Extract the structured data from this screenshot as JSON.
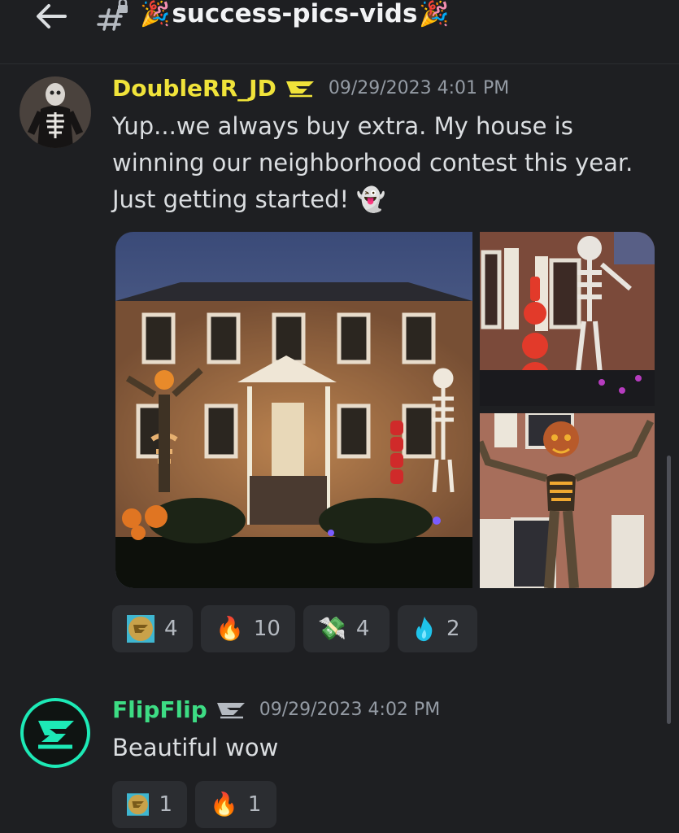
{
  "header": {
    "channel_prefix_emoji": "🎉",
    "channel_name": "success-pics-vids",
    "channel_suffix_emoji": "🎉"
  },
  "messages": [
    {
      "author": "DoubleRR_JD",
      "author_color": "#f0e33a",
      "timestamp": "09/29/2023 4:01 PM",
      "lines": [
        "Yup...we always buy extra. My house is",
        "winning our neighborhood contest this year.",
        "Just getting started! 👻"
      ],
      "images": [
        "halloween-house-front",
        "skull-column-and-skeleton",
        "pumpkin-skeleton-closeup"
      ],
      "reactions": [
        {
          "icon": "flipflip-coin-emoji",
          "count": "4"
        },
        {
          "emoji": "🔥",
          "count": "10"
        },
        {
          "emoji": "💸",
          "count": "4"
        },
        {
          "icon": "blue-fire-emoji",
          "count": "2"
        }
      ]
    },
    {
      "author": "FlipFlip",
      "author_color": "#3ddc84",
      "timestamp": "09/29/2023 4:02 PM",
      "lines": [
        "Beautiful wow"
      ],
      "reactions": [
        {
          "icon": "flipflip-coin-emoji",
          "count": "1"
        },
        {
          "emoji": "🔥",
          "count": "1"
        }
      ]
    }
  ],
  "colors": {
    "background": "#1e1f22",
    "reaction_bg": "#2b2d31",
    "timestamp": "#949ba4",
    "accent": "#1de9b6"
  }
}
